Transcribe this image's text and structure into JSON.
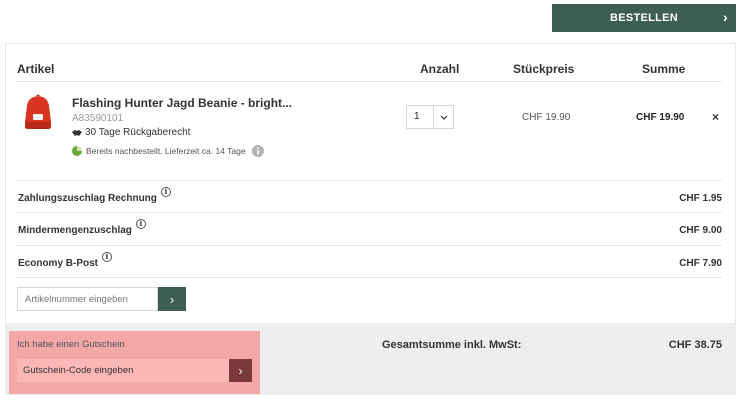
{
  "header": {
    "order_label": "BESTELLEN"
  },
  "table": {
    "headers": {
      "article": "Artikel",
      "quantity": "Anzahl",
      "unit_price": "Stückpreis",
      "total": "Summe"
    },
    "items": [
      {
        "name": "Flashing Hunter Jagd Beanie - bright...",
        "sku": "A83590101",
        "return_policy": "30 Tage Rückgaberecht",
        "stock_status": "Bereits nachbestellt. Lieferzeit ca. 14 Tage",
        "quantity": "1",
        "unit_price": "CHF 19.90",
        "line_total": "CHF 19.90",
        "remove_symbol": "×"
      }
    ]
  },
  "fees": [
    {
      "label": "Zahlungszuschlag Rechnung",
      "amount": "CHF 1.95"
    },
    {
      "label": "Mindermengenzuschlag",
      "amount": "CHF 9.00"
    },
    {
      "label": "Economy B-Post",
      "amount": "CHF 7.90"
    }
  ],
  "sku_entry": {
    "placeholder": "Artikelnummer eingeben"
  },
  "voucher": {
    "label": "Ich habe einen Gutschein",
    "placeholder": "Gutschein-Code eingeben"
  },
  "summary": {
    "label": "Gesamtsumme inkl. MwSt:",
    "value": "CHF 38.75"
  },
  "colors": {
    "accent": "#3e5e51",
    "voucher_highlight": "#f4a7a7",
    "product": "#d8341f"
  }
}
